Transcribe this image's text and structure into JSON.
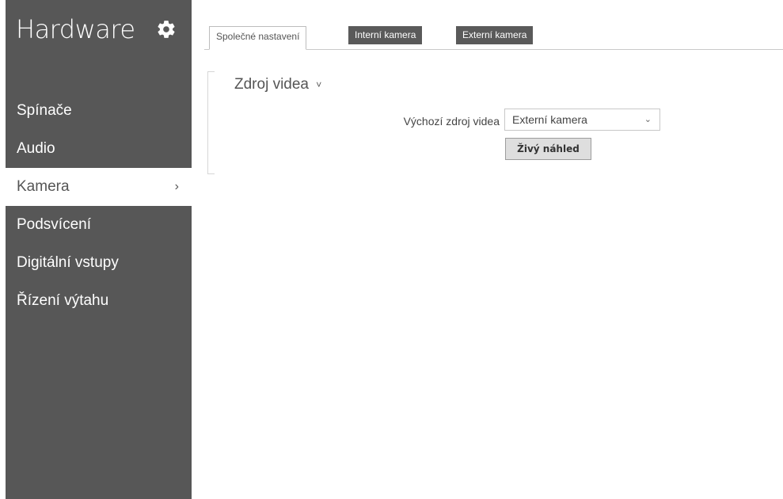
{
  "sidebar": {
    "title": "Hardware",
    "gear_icon": "gear-icon",
    "items": [
      {
        "label": "Spínače"
      },
      {
        "label": "Audio"
      },
      {
        "label": "Kamera",
        "chevron": "›"
      },
      {
        "label": "Podsvícení"
      },
      {
        "label": "Digitální vstupy"
      },
      {
        "label": "Řízení výtahu"
      }
    ]
  },
  "tabs": [
    {
      "label": "Společné nastavení"
    },
    {
      "label": "Interní kamera"
    },
    {
      "label": "Externí kamera"
    }
  ],
  "section": {
    "title": "Zdroj videa",
    "caret": "˅",
    "field_label": "Výchozí zdroj videa",
    "select_value": "Externí kamera",
    "select_arrow": "⌄",
    "button_label": "Živý náhled"
  },
  "colors": {
    "sidebar_bg": "#575757",
    "tab_inactive_bg": "#5a5a5a",
    "button_bg": "#dedede"
  }
}
